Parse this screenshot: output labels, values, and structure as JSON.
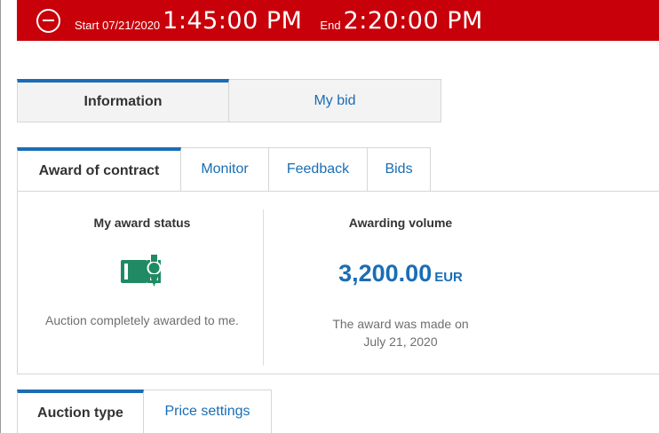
{
  "timebar": {
    "start_label": "Start",
    "start_date": "07/21/2020",
    "start_time": "1:45:00 PM",
    "end_label": "End",
    "end_time": "2:20:00 PM",
    "color": "#c8000a"
  },
  "top_tabs": [
    {
      "label": "Information",
      "active": true
    },
    {
      "label": "My bid",
      "active": false
    }
  ],
  "sub_tabs": [
    {
      "label": "Award of contract",
      "active": true
    },
    {
      "label": "Monitor",
      "active": false
    },
    {
      "label": "Feedback",
      "active": false
    },
    {
      "label": "Bids",
      "active": false
    }
  ],
  "award": {
    "status_heading": "My award status",
    "status_icon": "award-certificate-icon",
    "status_text": "Auction completely awarded to me.",
    "volume_heading": "Awarding volume",
    "volume_amount": "3,200.00",
    "volume_currency": "EUR",
    "award_note_line1": "The award was made on",
    "award_note_line2": "July 21, 2020"
  },
  "bottom_tabs": [
    {
      "label": "Auction type",
      "active": true
    },
    {
      "label": "Price settings",
      "active": false
    }
  ],
  "colors": {
    "accent": "#1a6db5",
    "icon_green": "#1f8a63"
  }
}
